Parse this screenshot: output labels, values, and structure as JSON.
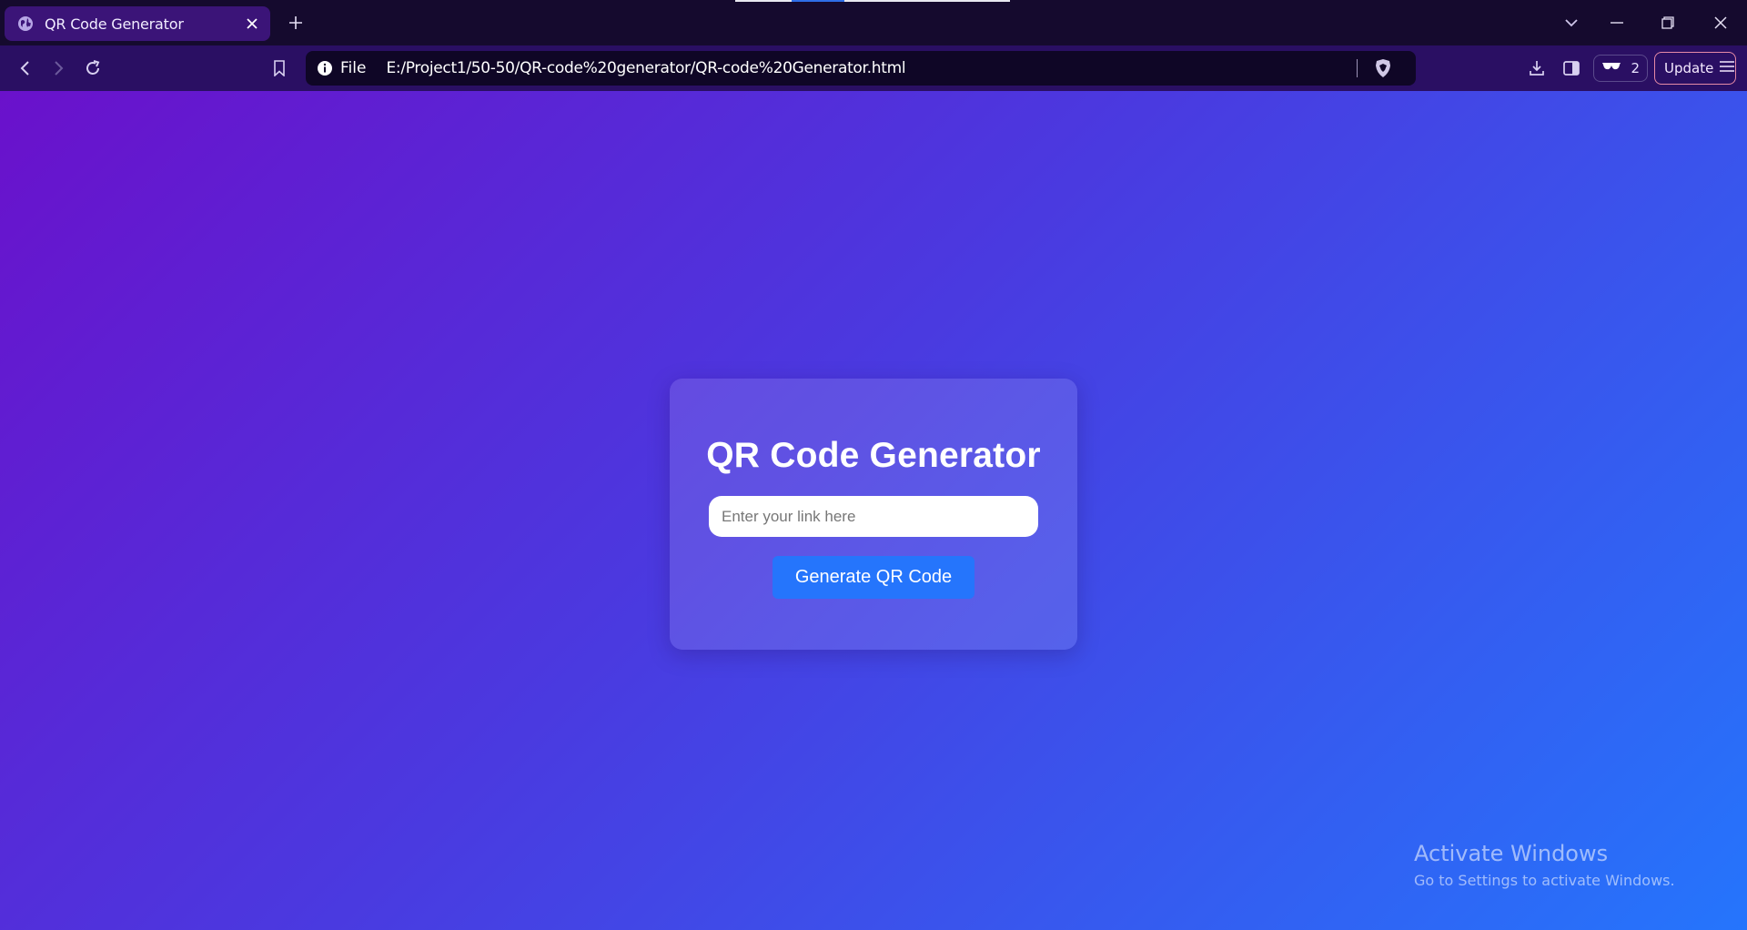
{
  "browser": {
    "tab": {
      "title": "QR Code Generator"
    },
    "address_bar": {
      "scheme_label": "File",
      "url": "E:/Project1/50-50/QR-code%20generator/QR-code%20Generator.html"
    },
    "vpn_count": "2",
    "update_label": "Update"
  },
  "page": {
    "heading": "QR Code Generator",
    "input": {
      "value": "",
      "placeholder": "Enter your link here"
    },
    "generate_button_label": "Generate QR Code",
    "gradient_colors": [
      "#6a11cb",
      "#2575fc"
    ],
    "button_color": "#2575fc"
  },
  "watermark": {
    "title": "Activate Windows",
    "subtitle": "Go to Settings to activate Windows."
  },
  "icons": [
    "globe-icon",
    "close-icon",
    "plus-icon",
    "chevron-down-icon",
    "minimize-icon",
    "restore-icon",
    "back-icon",
    "forward-icon",
    "reload-icon",
    "bookmark-icon",
    "info-icon",
    "brave-shield-icon",
    "download-icon",
    "sidebar-icon",
    "vpn-glasses-icon",
    "hamburger-icon"
  ]
}
